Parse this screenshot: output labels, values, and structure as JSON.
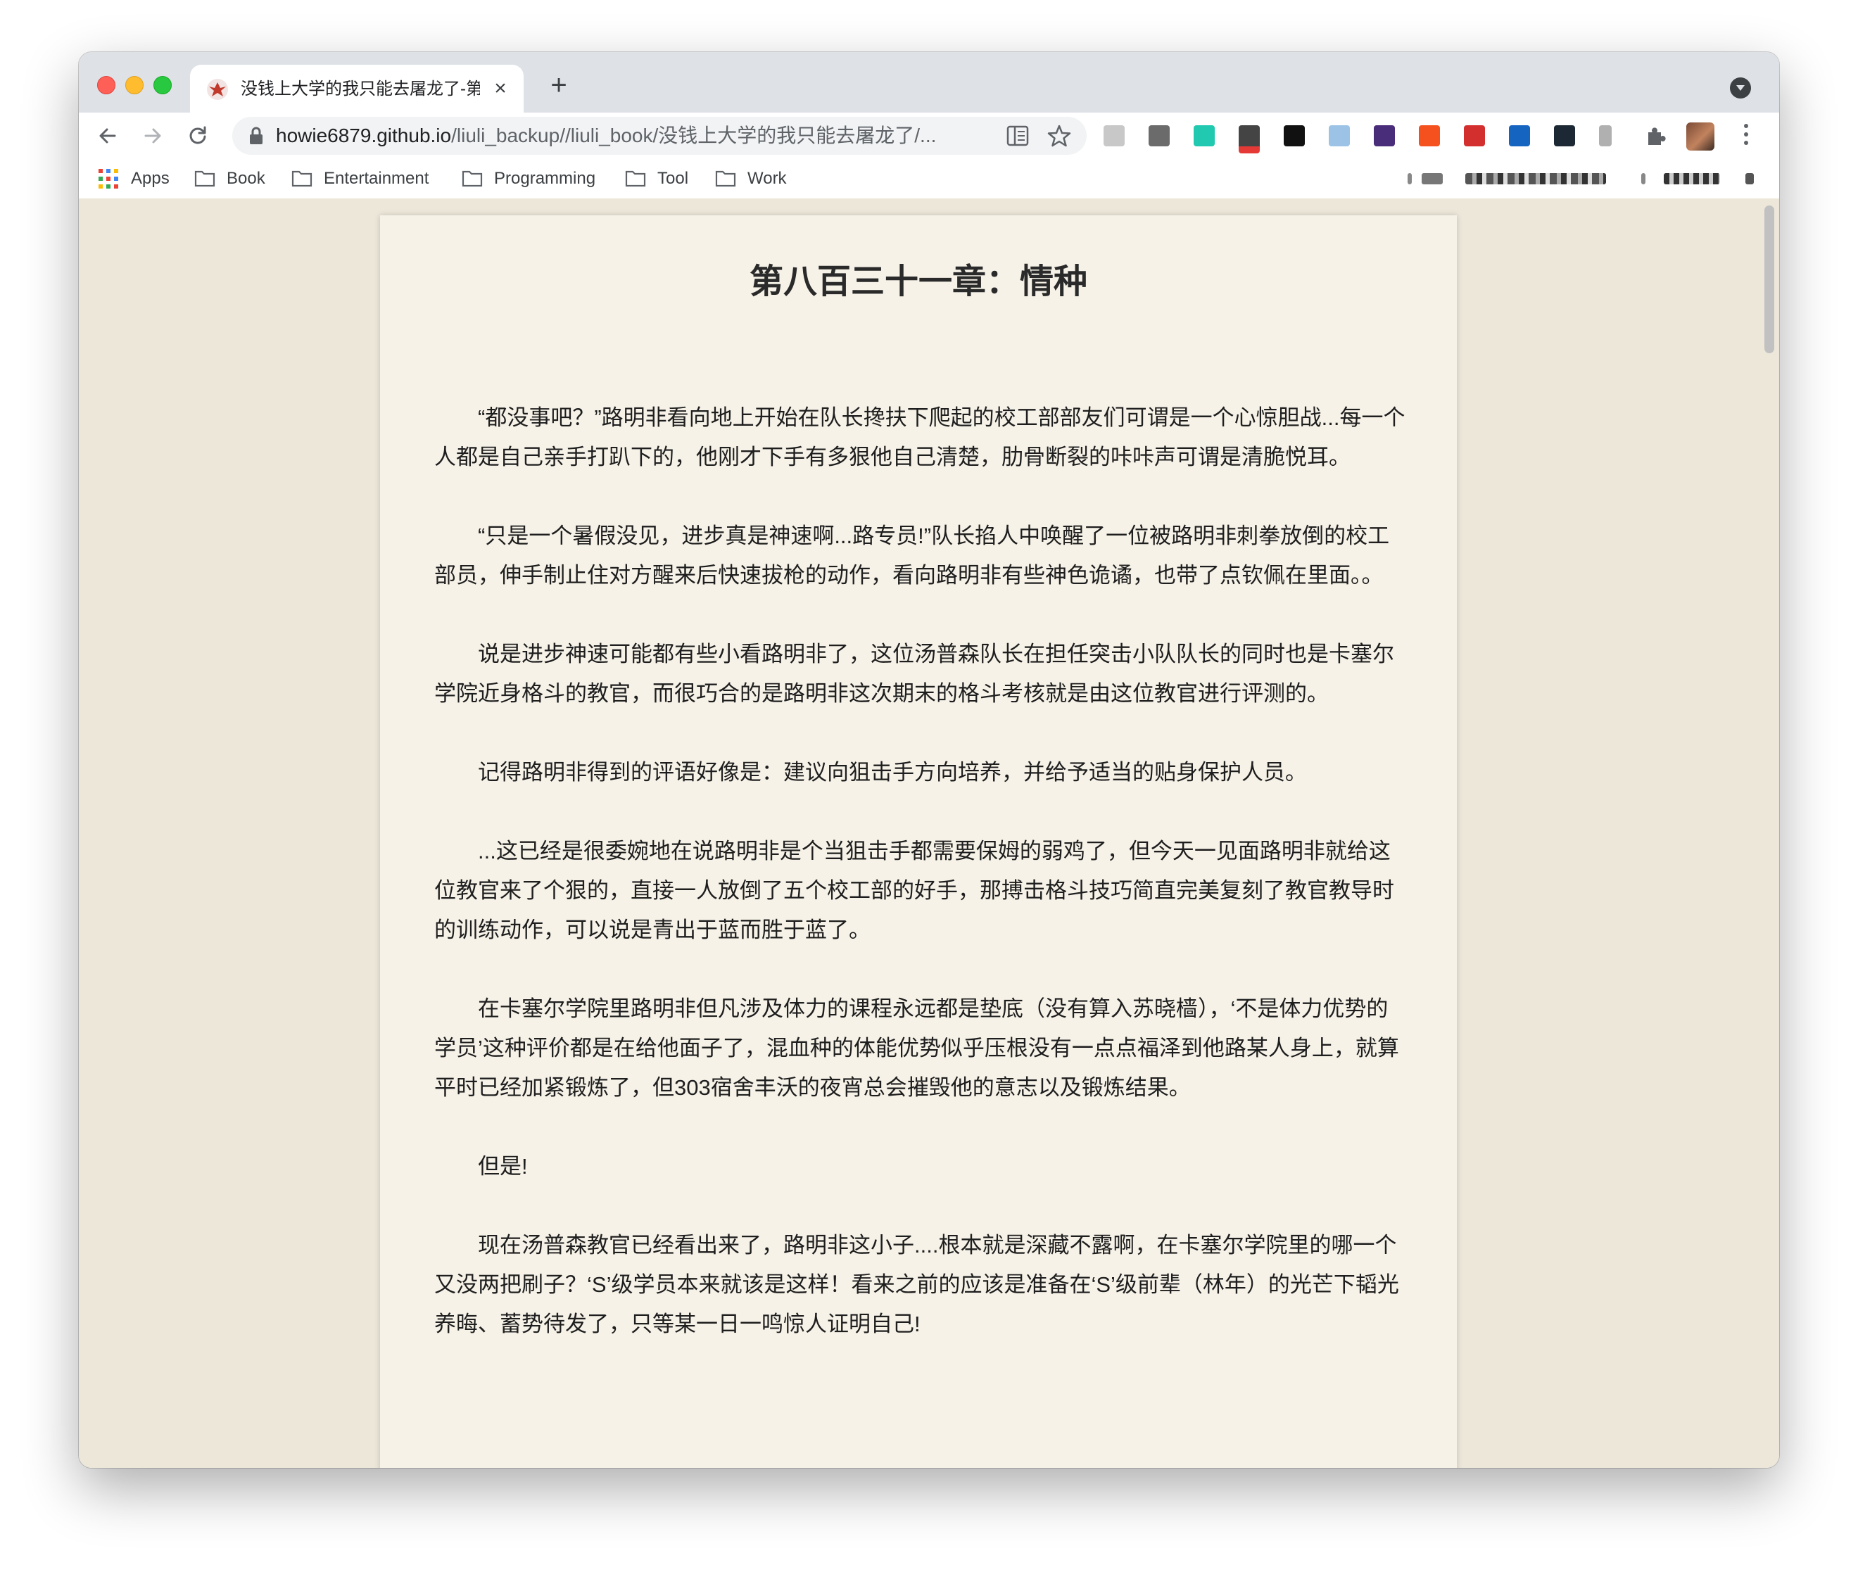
{
  "tab": {
    "title": "没钱上大学的我只能去屠龙了-第",
    "close_glyph": "×",
    "new_tab_glyph": "+"
  },
  "toolbar": {
    "url_host": "howie6879.github.io",
    "url_path": "/liuli_backup//liuli_book/没钱上大学的我只能去屠龙了/..."
  },
  "bookmarks": [
    {
      "label": "Apps",
      "icon": "apps-grid-icon"
    },
    {
      "label": "Book",
      "icon": "folder-icon"
    },
    {
      "label": "Entertainment",
      "icon": "folder-icon"
    },
    {
      "label": "Programming",
      "icon": "folder-icon"
    },
    {
      "label": "Tool",
      "icon": "folder-icon"
    },
    {
      "label": "Work",
      "icon": "folder-icon"
    }
  ],
  "article": {
    "title": "第八百三十一章：情种",
    "paragraphs": [
      "“都没事吧？”路明非看向地上开始在队长搀扶下爬起的校工部部友们可谓是一个心惊胆战...每一个人都是自己亲手打趴下的，他刚才下手有多狠他自己清楚，肋骨断裂的咔咔声可谓是清脆悦耳。",
      "“只是一个暑假没见，进步真是神速啊...路专员!”队长掐人中唤醒了一位被路明非刺拳放倒的校工部员，伸手制止住对方醒来后快速拔枪的动作，看向路明非有些神色诡谲，也带了点钦佩在里面。。",
      "说是进步神速可能都有些小看路明非了，这位汤普森队长在担任突击小队队长的同时也是卡塞尔学院近身格斗的教官，而很巧合的是路明非这次期末的格斗考核就是由这位教官进行评测的。",
      "记得路明非得到的评语好像是：建议向狙击手方向培养，并给予适当的贴身保护人员。",
      "...这已经是很委婉地在说路明非是个当狙击手都需要保姆的弱鸡了，但今天一见面路明非就给这位教官来了个狠的，直接一人放倒了五个校工部的好手，那搏击格斗技巧简直完美复刻了教官教导时的训练动作，可以说是青出于蓝而胜于蓝了。",
      "在卡塞尔学院里路明非但凡涉及体力的课程永远都是垫底（没有算入苏晓樯），‘不是体力优势的学员’这种评价都是在给他面子了，混血种的体能优势似乎压根没有一点点福泽到他路某人身上，就算平时已经加紧锻炼了，但303宿舍丰沃的夜宵总会摧毁他的意志以及锻炼结果。",
      "但是!",
      "现在汤普森教官已经看出来了，路明非这小子....根本就是深藏不露啊，在卡塞尔学院里的哪一个又没两把刷子？‘S’级学员本来就该是这样！看来之前的应该是准备在‘S’级前辈（林年）的光芒下韬光养晦、蓄势待发了，只等某一日一鸣惊人证明自己!"
    ]
  }
}
